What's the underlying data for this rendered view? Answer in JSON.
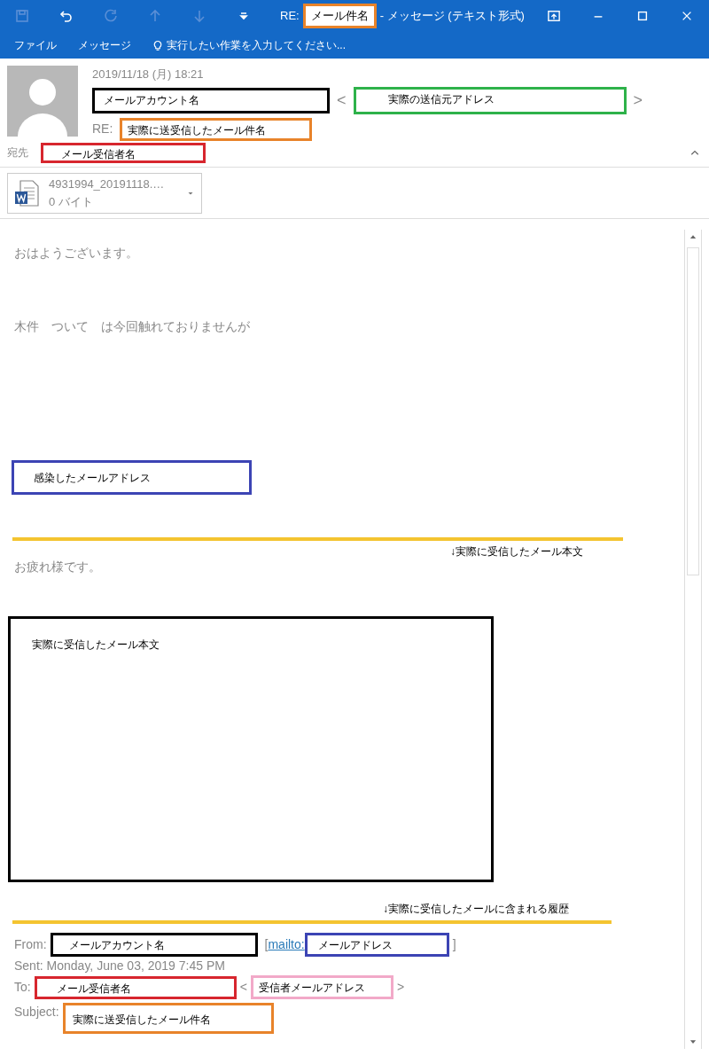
{
  "titlebar": {
    "quick_access": [
      {
        "kind": "save",
        "disabled": true
      },
      {
        "kind": "undo",
        "disabled": false
      },
      {
        "kind": "redo",
        "disabled": true
      },
      {
        "kind": "up",
        "disabled": true
      },
      {
        "kind": "down",
        "disabled": true
      },
      {
        "kind": "customize",
        "disabled": false
      }
    ],
    "prefix": "RE:",
    "subject": {
      "text": "メール件名",
      "color": "#e8832a"
    },
    "suffix": "- メッセージ (テキスト形式)"
  },
  "ribbon": {
    "tabs": [
      {
        "label": "ファイル"
      },
      {
        "label": "メッセージ"
      }
    ],
    "tell_me": "実行したい作業を入力してください..."
  },
  "header": {
    "date": "2019/11/18 (月) 18:21",
    "sender": {
      "text": "メールアカウント名",
      "color": "#000000"
    },
    "open_bracket": "<",
    "address": {
      "text": "実際の送信元アドレス",
      "color": "#2eb24a"
    },
    "close_bracket": ">",
    "subject_prefix": "RE:",
    "subject": {
      "text": "実際に送受信したメール件名",
      "color": "#e8832a"
    },
    "to_label": "宛先",
    "to": {
      "text": "メール受信者名",
      "color": "#d7262e"
    }
  },
  "attachment": {
    "name": "4931994_20191118.…",
    "size": "0 バイト"
  },
  "body": {
    "greeting": "おはようございます。",
    "line": "木件　ついて　は今回触れておりませんが",
    "infected": {
      "text": "感染したメールアドレス",
      "color": "#3c44b4"
    },
    "note1": "↓実際に受信したメール本文",
    "greeting2": "お疲れ様です。",
    "received": {
      "text": "実際に受信したメール本文",
      "color": "#000000"
    },
    "note2": "↓実際に受信したメールに含まれる履歴",
    "history": {
      "from_label": "From:",
      "from": {
        "text": "メールアカウント名",
        "color": "#000000"
      },
      "open_bracket": "[",
      "mailto": "mailto:",
      "from_address": {
        "text": "メールアドレス",
        "color": "#3c44b4"
      },
      "close_bracket": "]",
      "sent": "Sent: Monday, June 03, 2019 7:45 PM",
      "to_label": "To:",
      "to": {
        "text": "メール受信者名",
        "color": "#d7262e"
      },
      "to_open": "<",
      "to_address": {
        "text": "受信者メールアドレス",
        "color": "#f2a9c8"
      },
      "to_close": ">",
      "subject_label": "Subject:",
      "subject": {
        "text": "実際に送受信したメール件名",
        "color": "#e8832a"
      }
    }
  }
}
